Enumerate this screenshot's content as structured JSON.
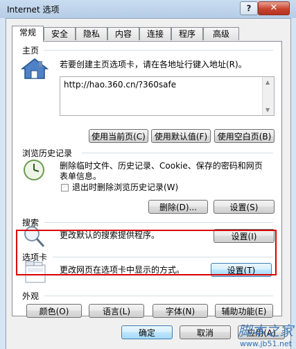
{
  "window": {
    "title": "Internet 选项",
    "help_label": "?",
    "close_label": "✕"
  },
  "tabs": [
    "常规",
    "安全",
    "隐私",
    "内容",
    "连接",
    "程序",
    "高级"
  ],
  "home": {
    "heading": "主页",
    "description": "若要创建主页选项卡，请在各地址行键入地址(R)。",
    "url": "http://hao.360.cn/?360safe",
    "buttons": [
      "使用当前页(C)",
      "使用默认值(F)",
      "使用空白页(B)"
    ]
  },
  "history": {
    "heading": "浏览历史记录",
    "description": "删除临时文件、历史记录、Cookie、保存的密码和网页表单信息。",
    "checkbox_label": "退出时删除浏览历史记录(W)",
    "delete_button": "删除(D)...",
    "settings_button": "设置(S)"
  },
  "search": {
    "heading": "搜索",
    "description": "更改默认的搜索提供程序。",
    "settings_button": "设置(I)"
  },
  "tabsection": {
    "heading": "选项卡",
    "description": "更改网页在选项卡中显示的方式。",
    "settings_button": "设置(T)"
  },
  "appearance": {
    "heading": "外观",
    "buttons": [
      "颜色(O)",
      "语言(L)",
      "字体(N)",
      "辅助功能(E)"
    ]
  },
  "footer": {
    "ok": "确定",
    "cancel": "取消",
    "apply": "应用(A)"
  },
  "watermark": {
    "text": "脚本之家",
    "url": "www.jb51.net"
  },
  "colors": {
    "highlight": "#d90000",
    "titlebar": "#b6cde6"
  }
}
